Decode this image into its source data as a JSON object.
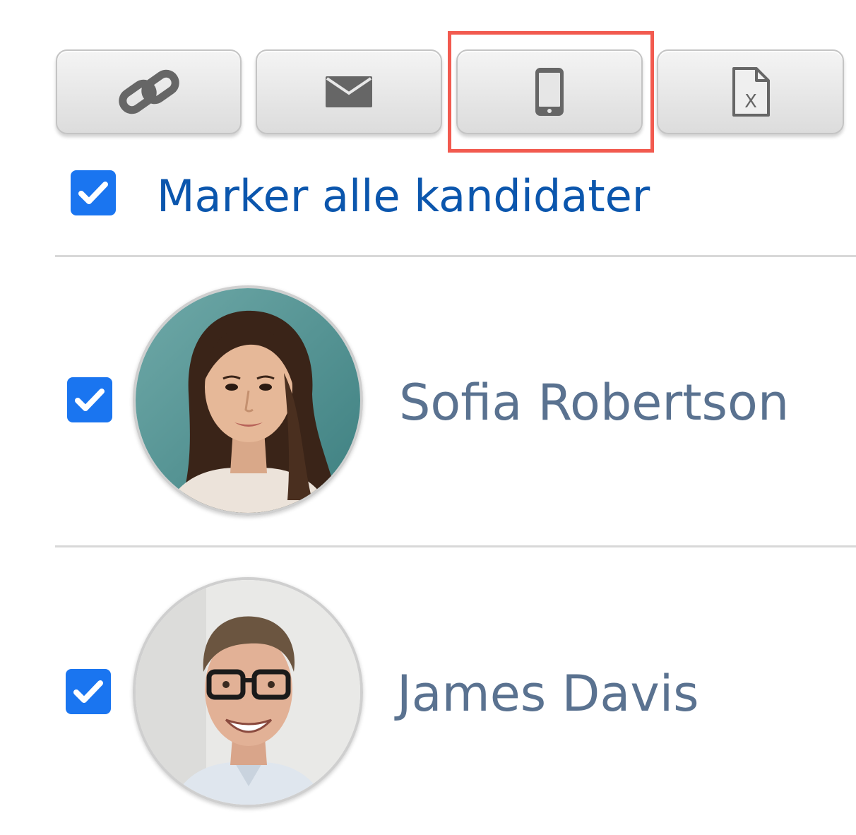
{
  "toolbar": {
    "buttons": [
      {
        "id": "copy-link",
        "icon": "link-icon"
      },
      {
        "id": "send-email",
        "icon": "envelope-icon"
      },
      {
        "id": "send-sms",
        "icon": "mobile-phone-icon",
        "highlighted": true
      },
      {
        "id": "export-excel",
        "icon": "excel-file-icon",
        "icon_letter": "X"
      }
    ],
    "highlight_color": "#f25a4f"
  },
  "select_all": {
    "checked": true,
    "label": "Marker alle kandidater"
  },
  "candidates": [
    {
      "name": "Sofia Robertson",
      "checked": true,
      "avatar": "avatar-photo-woman"
    },
    {
      "name": "James Davis",
      "checked": true,
      "avatar": "avatar-photo-man"
    }
  ],
  "colors": {
    "checkbox": "#1a75f0",
    "link_text": "#0b56ad",
    "name_text": "#5a7290",
    "icon": "#666666"
  }
}
